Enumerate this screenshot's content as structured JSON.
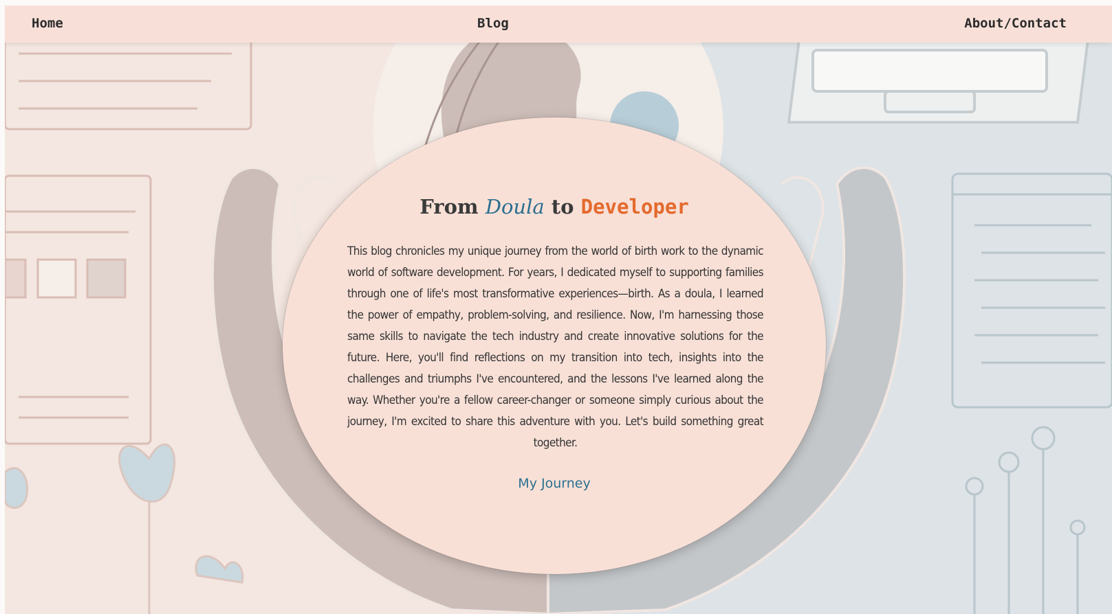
{
  "nav": {
    "home": "Home",
    "blog": "Blog",
    "about_contact": "About/Contact"
  },
  "hero": {
    "title_from": "From",
    "title_doula": "Doula",
    "title_to": "to",
    "title_developer": "Developer",
    "description": "This blog chronicles my unique journey from the world of birth work to the dynamic world of software development. For years, I dedicated myself to supporting families through one of life's most transformative experiences—birth. As a doula, I learned the power of empathy, problem-solving, and resilience. Now, I'm harnessing those same skills to navigate the tech industry and create innovative solutions for the future. Here, you'll find reflections on my transition into tech, insights into the challenges and triumphs I've encountered, and the lessons I've learned along the way. Whether you're a fellow career-changer or someone simply curious about the journey, I'm excited to share this adventure with you. Let's build something great together.",
    "cta": "My Journey"
  },
  "colors": {
    "nav_bg": "#f8e0d8",
    "oval_bg": "#f8e0d7",
    "accent_blue": "#2a6f8f",
    "accent_orange": "#e46a2d",
    "text_dark": "#333333",
    "bg_left": "#f4e6e0",
    "bg_right": "#dde3e6"
  },
  "background": {
    "description_icons": [
      "browser-window-icon",
      "hands-icon",
      "woman-silhouette-icon",
      "laptop-icon",
      "tulip-icon",
      "circuit-icon"
    ]
  }
}
